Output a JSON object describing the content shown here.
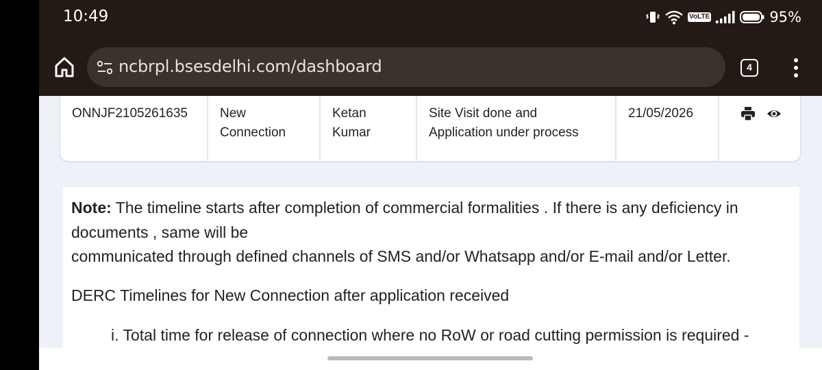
{
  "status_bar": {
    "time": "10:49",
    "volte_label": "VoLTE",
    "battery_percent": "95%"
  },
  "browser": {
    "url": "ncbrpl.bsesdelhi.com/dashboard",
    "tab_count": "4"
  },
  "application_row": {
    "application_no": "ONNJF2105261635",
    "request_type": "New\nConnection",
    "applicant_name": "Ketan\nKumar",
    "status": "Site Visit done and\nApplication under process",
    "date": "21/05/2026",
    "actions": [
      "print-icon",
      "view-icon"
    ]
  },
  "note": {
    "label": "Note:",
    "text": " The timeline starts after completion of commercial formalities . If there is any deficiency in documents , same will be",
    "line3": "communicated through defined channels of SMS and/or Whatsapp and/or E-mail and/or Letter.",
    "derc_heading": "DERC Timelines for New Connection after application received",
    "timeline_item": "i. Total time for release of connection where no RoW or road cutting permission is required -"
  },
  "colors": {
    "browser_chrome": "#231a16",
    "url_pill": "#3b322e",
    "page_background": "#eef2f8"
  }
}
